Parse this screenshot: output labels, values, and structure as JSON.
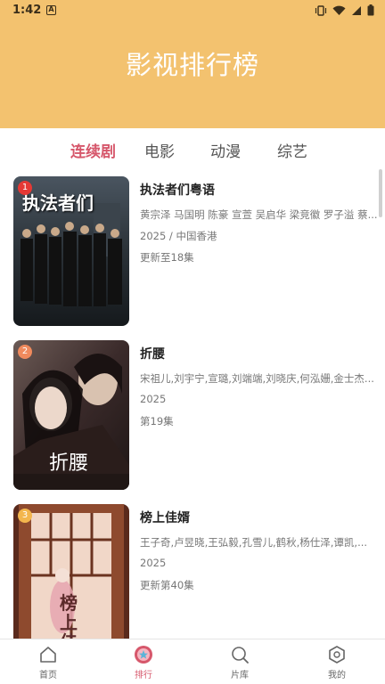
{
  "status_bar": {
    "time": "1:42",
    "app_badge": "A"
  },
  "header": {
    "title": "影视排行榜"
  },
  "tabs": [
    {
      "label": "连续剧",
      "active": true
    },
    {
      "label": "电影",
      "active": false
    },
    {
      "label": "动漫",
      "active": false
    },
    {
      "label": "综艺",
      "active": false
    }
  ],
  "items": [
    {
      "rank": "1",
      "rank_color": "#e53935",
      "poster_text": "执法者们",
      "title": "执法者们粤语",
      "cast": "黄宗泽 马国明 陈豪 宣萱 吴启华 梁竞徽 罗子溢 蔡...",
      "year_region": "2025 / 中国香港",
      "episode": "更新至18集"
    },
    {
      "rank": "2",
      "rank_color": "#f08a5d",
      "poster_text": "折腰",
      "title": "折腰",
      "cast": "宋祖儿,刘宇宁,宣璐,刘端端,刘晓庆,何泓姗,金士杰...",
      "year_region": "2025",
      "episode": " 第19集"
    },
    {
      "rank": "3",
      "rank_color": "#f3b64d",
      "poster_text": "榜上佳婿",
      "title": "榜上佳婿",
      "cast": "王子奇,卢昱晓,王弘毅,孔雪儿,鹤秋,杨仕泽,谭凯,...",
      "year_region": "2025",
      "episode": "更新第40集"
    }
  ],
  "bottom_nav": [
    {
      "label": "首页",
      "icon": "home-icon",
      "active": false
    },
    {
      "label": "排行",
      "icon": "rank-icon",
      "active": true
    },
    {
      "label": "片库",
      "icon": "search-icon",
      "active": false
    },
    {
      "label": "我的",
      "icon": "profile-icon",
      "active": false
    }
  ]
}
